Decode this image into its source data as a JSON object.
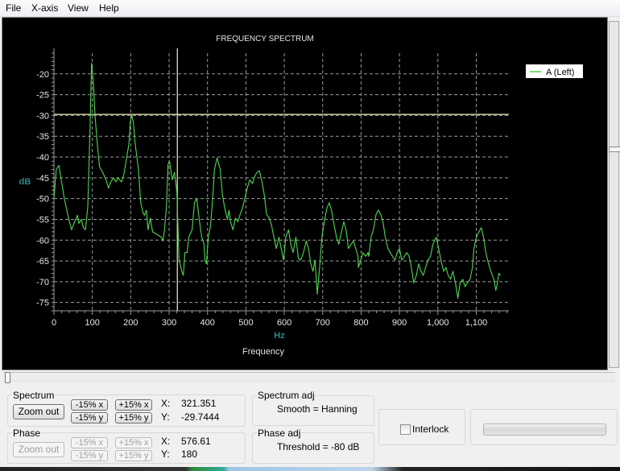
{
  "menu": [
    "File",
    "X-axis",
    "View",
    "Help"
  ],
  "chart_data": {
    "type": "line",
    "title": "FREQUENCY SPECTRUM",
    "xlabel_unit": "Hz",
    "xlabel": "Frequency",
    "ylabel": "dB",
    "xlim": [
      0,
      1185
    ],
    "ylim": [
      -77,
      -15
    ],
    "xticks": [
      0,
      100,
      200,
      300,
      400,
      500,
      600,
      700,
      800,
      900,
      1000,
      1100
    ],
    "xtick_labels": [
      "0",
      "100",
      "200",
      "300",
      "400",
      "500",
      "600",
      "700",
      "800",
      "900",
      "1,000",
      "1,100"
    ],
    "yticks": [
      -20,
      -25,
      -30,
      -35,
      -40,
      -45,
      -50,
      -55,
      -60,
      -65,
      -70,
      -75
    ],
    "ytick_labels": [
      "-20",
      "-25",
      "-30",
      "-35",
      "-40",
      "-45",
      "-50",
      "-55",
      "-60",
      "-65",
      "-70",
      "-75"
    ],
    "grid": true,
    "legend_position": "top-right",
    "cursor": {
      "x": 321.351,
      "y": -29.7444
    },
    "colors": {
      "series": "#4fd64f",
      "cursor": "#f2f2c0",
      "grid": "#9a9a9a",
      "axis_label": "#2a8a8a",
      "text": "#e6e6e6"
    },
    "series": [
      {
        "name": "A (Left)",
        "x": [
          0,
          6,
          13,
          19,
          27,
          38,
          46,
          54,
          61,
          65,
          71,
          77,
          82,
          88,
          94,
          98,
          103,
          107,
          113,
          119,
          127,
          136,
          142,
          148,
          155,
          161,
          167,
          176,
          182,
          188,
          195,
          199,
          203,
          207,
          211,
          220,
          226,
          232,
          236,
          241,
          245,
          251,
          257,
          266,
          280,
          284,
          288,
          293,
          297,
          301,
          308,
          314,
          320,
          326,
          333,
          337,
          341,
          347,
          351,
          360,
          366,
          372,
          378,
          385,
          391,
          393,
          397,
          402,
          408,
          414,
          418,
          425,
          433,
          439,
          446,
          452,
          456,
          460,
          466,
          473,
          479,
          485,
          492,
          498,
          504,
          510,
          517,
          523,
          529,
          535,
          542,
          548,
          554,
          561,
          567,
          573,
          579,
          586,
          592,
          598,
          604,
          611,
          617,
          623,
          630,
          637,
          643,
          650,
          657,
          663,
          669,
          675,
          680,
          686,
          692,
          698,
          704,
          711,
          717,
          723,
          730,
          736,
          742,
          748,
          755,
          761,
          767,
          774,
          780,
          786,
          792,
          793,
          799,
          805,
          812,
          818,
          820,
          826,
          832,
          839,
          845,
          851,
          857,
          863,
          870,
          876,
          882,
          888,
          894,
          900,
          906,
          913,
          919,
          925,
          931,
          937,
          944,
          950,
          956,
          962,
          968,
          974,
          981,
          987,
          991,
          996,
          1002,
          1008,
          1015,
          1021,
          1027,
          1033,
          1039,
          1046,
          1052,
          1058,
          1065,
          1071,
          1077,
          1084,
          1090,
          1094,
          1100,
          1107,
          1113,
          1119,
          1125,
          1132,
          1138,
          1142,
          1146,
          1151,
          1155,
          1159,
          1163
        ],
        "y": [
          -50,
          -43,
          -42,
          -45.5,
          -50,
          -54.7,
          -57.5,
          -55.6,
          -54,
          -56,
          -55,
          -57,
          -57.5,
          -52,
          -33.5,
          -17.4,
          -22.6,
          -30,
          -37,
          -42.4,
          -43.7,
          -45.5,
          -47.5,
          -46,
          -45,
          -46,
          -45,
          -46,
          -44.2,
          -41,
          -37,
          -31.4,
          -30,
          -31.7,
          -36.3,
          -43,
          -51,
          -53.4,
          -54,
          -52.8,
          -57.5,
          -54.7,
          -58,
          -58.5,
          -59.3,
          -60.2,
          -57.5,
          -52,
          -41.8,
          -41,
          -45.5,
          -43.7,
          -48.3,
          -64.8,
          -67.5,
          -68.5,
          -63,
          -63,
          -59.3,
          -57.5,
          -51,
          -50,
          -54.7,
          -59.3,
          -61,
          -64.8,
          -65.7,
          -59.3,
          -56.5,
          -49.2,
          -43,
          -40.2,
          -43,
          -49.2,
          -52.8,
          -55,
          -52.8,
          -55.6,
          -57.5,
          -54.7,
          -55.6,
          -53.8,
          -52,
          -49.7,
          -47.3,
          -45.5,
          -46.4,
          -44.6,
          -43.7,
          -43.3,
          -46,
          -49.2,
          -53.8,
          -54.7,
          -56.5,
          -59.3,
          -62,
          -59.3,
          -62,
          -64.8,
          -59.3,
          -57.5,
          -61,
          -63,
          -59.3,
          -64.4,
          -64.8,
          -63,
          -60.2,
          -62,
          -65.7,
          -67.5,
          -64.8,
          -73,
          -66.6,
          -59.3,
          -55.6,
          -52.3,
          -51,
          -52.8,
          -56.5,
          -59.3,
          -61,
          -58.4,
          -55.6,
          -57.5,
          -62,
          -61,
          -60.2,
          -62,
          -63.9,
          -66.6,
          -64.8,
          -63,
          -63.9,
          -63,
          -63.9,
          -59.3,
          -57.5,
          -53.8,
          -52.8,
          -53.8,
          -55.6,
          -59.3,
          -62,
          -63,
          -63.9,
          -64.8,
          -63,
          -62,
          -64.8,
          -63.9,
          -63,
          -63.9,
          -66.6,
          -70.3,
          -68.5,
          -65.7,
          -67.5,
          -68.5,
          -66.6,
          -64.8,
          -63.9,
          -61,
          -60.2,
          -59.3,
          -62,
          -64.8,
          -67.5,
          -66.6,
          -68.5,
          -69.4,
          -67.5,
          -70.3,
          -74,
          -70.3,
          -69.4,
          -71.2,
          -70.3,
          -69.4,
          -66.6,
          -62,
          -59.3,
          -58,
          -57,
          -59.3,
          -63,
          -65.7,
          -67.5,
          -68.5,
          -69.4,
          -72.1,
          -70.3,
          -68,
          -68.5,
          -69.4,
          -67.5,
          -65.7,
          -63.9,
          -65.7,
          -63.9,
          -62.6,
          -64.8,
          -67.5,
          -70.3,
          -69.4
        ]
      }
    ]
  },
  "spectrum": {
    "label": "Spectrum",
    "zoom_out": "Zoom out",
    "minus_x": "-15% x",
    "plus_x": "+15% x",
    "minus_y": "-15% y",
    "plus_y": "+15% y",
    "x_label": "X:",
    "x_value": "321.351",
    "y_label": "Y:",
    "y_value": "-29.7444"
  },
  "phase": {
    "label": "Phase",
    "zoom_out": "Zoom out",
    "minus_x": "-15% x",
    "plus_x": "+15% x",
    "minus_y": "-15% y",
    "plus_y": "+15% y",
    "x_label": "X:",
    "x_value": "576.61",
    "y_label": "Y:",
    "y_value": "180"
  },
  "spectrum_adj": {
    "label": "Spectrum adj",
    "value": "Smooth = Hanning"
  },
  "phase_adj": {
    "label": "Phase adj",
    "value": "Threshold = -80 dB"
  },
  "interlock": {
    "label": "Interlock",
    "checked": false
  },
  "progress": {
    "value_percent": 0
  }
}
